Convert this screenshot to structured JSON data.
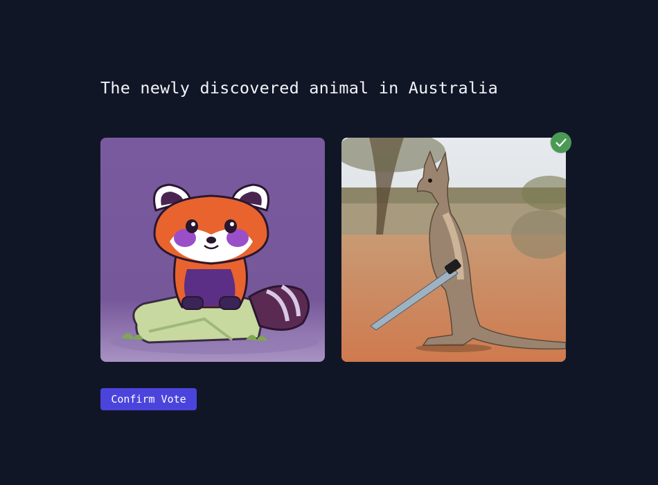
{
  "prompt": {
    "title": "The newly discovered animal in Australia"
  },
  "options": [
    {
      "subject": "red-panda-cartoon",
      "selected": false
    },
    {
      "subject": "kangaroo-with-saw",
      "selected": true
    }
  ],
  "selection_icon": "check-icon",
  "actions": {
    "confirm_label": "Confirm Vote"
  },
  "colors": {
    "background": "#111627",
    "accent": "#4b44dc",
    "selected_badge": "#4a9a55"
  }
}
